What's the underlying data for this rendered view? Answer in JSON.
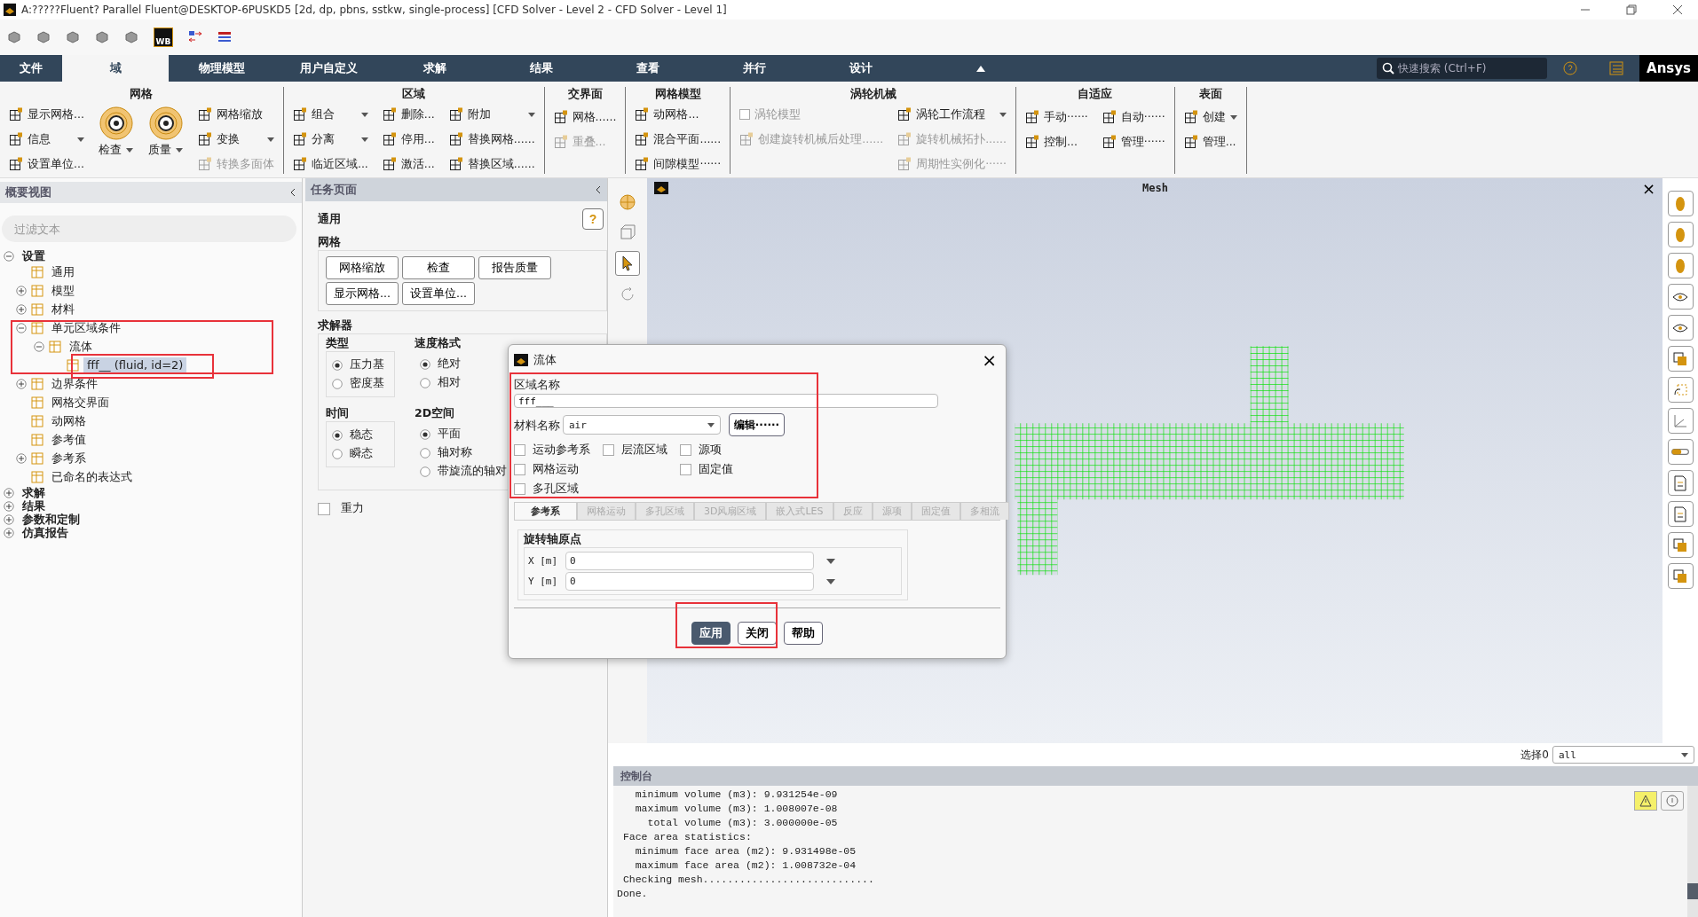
{
  "window": {
    "title": "A:?????Fluent? Parallel Fluent@DESKTOP-6PUSKD5  [2d, dp, pbns, sstkw, single-process] [CFD Solver - Level 2 - CFD Solver - Level 1]"
  },
  "quick_toolbar": {
    "wb_label": "WB"
  },
  "menu_tabs": [
    {
      "label": "文件",
      "selected": false
    },
    {
      "label": "域",
      "selected": true
    },
    {
      "label": "物理模型",
      "selected": false
    },
    {
      "label": "用户自定义",
      "selected": false
    },
    {
      "label": "求解",
      "selected": false
    },
    {
      "label": "结果",
      "selected": false
    },
    {
      "label": "查看",
      "selected": false
    },
    {
      "label": "并行",
      "selected": false
    },
    {
      "label": "设计",
      "selected": false
    }
  ],
  "search": {
    "placeholder": "快速搜索 (Ctrl+F)"
  },
  "brand": "Ansys",
  "ribbon": [
    {
      "title": "网格",
      "columns": [
        [
          {
            "label": "显示网格...",
            "kind": "small",
            "disabled": false,
            "dropdown": false
          },
          {
            "label": "信息",
            "kind": "small",
            "disabled": false,
            "dropdown": true
          },
          {
            "label": "设置单位...",
            "kind": "small",
            "disabled": false,
            "dropdown": false
          }
        ],
        [
          {
            "label": "检查",
            "kind": "large",
            "disabled": false,
            "dropdown": true
          }
        ],
        [
          {
            "label": "质量",
            "kind": "large",
            "disabled": false,
            "dropdown": true
          }
        ],
        [
          {
            "label": "网格缩放",
            "kind": "small",
            "disabled": false,
            "dropdown": false
          },
          {
            "label": "变换",
            "kind": "small",
            "disabled": false,
            "dropdown": true
          },
          {
            "label": "转换多面体",
            "kind": "small",
            "disabled": true,
            "dropdown": false
          }
        ]
      ]
    },
    {
      "title": "区域",
      "columns": [
        [
          {
            "label": "组合",
            "kind": "small",
            "disabled": false,
            "dropdown": true
          },
          {
            "label": "分离",
            "kind": "small",
            "disabled": false,
            "dropdown": true
          },
          {
            "label": "临近区域...",
            "kind": "small",
            "disabled": false,
            "dropdown": false
          }
        ],
        [
          {
            "label": "删除...",
            "kind": "small",
            "disabled": false,
            "dropdown": false
          },
          {
            "label": "停用...",
            "kind": "small",
            "disabled": false,
            "dropdown": false
          },
          {
            "label": "激活...",
            "kind": "small",
            "disabled": false,
            "dropdown": false
          }
        ],
        [
          {
            "label": "附加",
            "kind": "small",
            "disabled": false,
            "dropdown": true
          },
          {
            "label": "替换网格......",
            "kind": "small",
            "disabled": false,
            "dropdown": false
          },
          {
            "label": "替换区域......",
            "kind": "small",
            "disabled": false,
            "dropdown": false
          }
        ]
      ]
    },
    {
      "title": "交界面",
      "columns": [
        [
          {
            "label": "网格......",
            "kind": "small",
            "disabled": false,
            "dropdown": false
          },
          {
            "label": "重叠...",
            "kind": "small",
            "disabled": true,
            "dropdown": false
          }
        ]
      ]
    },
    {
      "title": "网格模型",
      "columns": [
        [
          {
            "label": "动网格...",
            "kind": "small",
            "disabled": false,
            "dropdown": false
          },
          {
            "label": "混合平面......",
            "kind": "small",
            "disabled": false,
            "dropdown": false
          },
          {
            "label": "间隙模型······",
            "kind": "small",
            "disabled": false,
            "dropdown": false
          }
        ]
      ]
    },
    {
      "title": "涡轮机械",
      "columns": [
        [
          {
            "label": "涡轮模型",
            "kind": "checkbox",
            "disabled": true,
            "checked": false
          },
          {
            "label": "创建旋转机械后处理......",
            "kind": "small",
            "disabled": true,
            "dropdown": false
          }
        ],
        [
          {
            "label": "涡轮工作流程",
            "kind": "small",
            "disabled": false,
            "dropdown": true
          },
          {
            "label": "旋转机械拓扑......",
            "kind": "small",
            "disabled": true,
            "dropdown": false
          },
          {
            "label": "周期性实例化······",
            "kind": "small",
            "disabled": true,
            "dropdown": false
          }
        ]
      ]
    },
    {
      "title": "自适应",
      "columns": [
        [
          {
            "label": "手动······",
            "kind": "small",
            "disabled": false,
            "dropdown": false
          },
          {
            "label": "控制...",
            "kind": "small",
            "disabled": false,
            "dropdown": false
          }
        ],
        [
          {
            "label": "自动······",
            "kind": "small",
            "disabled": false,
            "dropdown": false
          },
          {
            "label": "管理······",
            "kind": "small",
            "disabled": false,
            "dropdown": false
          }
        ]
      ]
    },
    {
      "title": "表面",
      "columns": [
        [
          {
            "label": "创建",
            "kind": "small",
            "disabled": false,
            "dropdown": true
          },
          {
            "label": "管理...",
            "kind": "small",
            "disabled": false,
            "dropdown": false
          }
        ]
      ]
    }
  ],
  "outline": {
    "title": "概要视图",
    "filter_placeholder": "过滤文本",
    "tree": [
      {
        "label": "设置",
        "expanded": true,
        "selected": false,
        "children": [
          {
            "label": "通用",
            "selected": false
          },
          {
            "label": "模型",
            "expanded": false,
            "selected": false
          },
          {
            "label": "材料",
            "expanded": false,
            "selected": false
          },
          {
            "label": "单元区域条件",
            "expanded": true,
            "selected": false,
            "children": [
              {
                "label": "流体",
                "expanded": true,
                "selected": false,
                "children": [
                  {
                    "label": "fff__ (fluid, id=2)",
                    "selected": true
                  }
                ]
              }
            ]
          },
          {
            "label": "边界条件",
            "expanded": false,
            "selected": false
          },
          {
            "label": "网格交界面",
            "selected": false
          },
          {
            "label": "动网格",
            "selected": false
          },
          {
            "label": "参考值",
            "selected": false
          },
          {
            "label": "参考系",
            "expanded": false,
            "selected": false
          },
          {
            "label": "已命名的表达式",
            "selected": false
          }
        ]
      },
      {
        "label": "求解",
        "expanded": false,
        "selected": false
      },
      {
        "label": "结果",
        "expanded": false,
        "selected": false
      },
      {
        "label": "参数和定制",
        "expanded": false,
        "selected": false
      },
      {
        "label": "仿真报告",
        "expanded": false,
        "selected": false
      }
    ]
  },
  "task_page": {
    "title": "任务页面",
    "section": "通用",
    "help": "?",
    "mesh_title": "网格",
    "mesh_buttons": [
      [
        "网格缩放",
        "检查",
        "报告质量"
      ],
      [
        "显示网格...",
        "设置单位..."
      ]
    ],
    "solver_title": "求解器",
    "radio_groups": [
      {
        "title": "类型",
        "options": [
          {
            "label": "压力基",
            "selected": true
          },
          {
            "label": "密度基",
            "selected": false
          }
        ]
      },
      {
        "title": "速度格式",
        "options": [
          {
            "label": "绝对",
            "selected": true
          },
          {
            "label": "相对",
            "selected": false
          }
        ]
      },
      {
        "title": "时间",
        "options": [
          {
            "label": "稳态",
            "selected": true
          },
          {
            "label": "瞬态",
            "selected": false
          }
        ]
      },
      {
        "title": "2D空间",
        "options": [
          {
            "label": "平面",
            "selected": true
          },
          {
            "label": "轴对称",
            "selected": false
          },
          {
            "label": "带旋流的轴对",
            "selected": false
          }
        ]
      }
    ],
    "gravity": {
      "label": "重力",
      "checked": false
    }
  },
  "graphics": {
    "title": "Mesh",
    "close": "×"
  },
  "selection": {
    "label": "选择0",
    "value": "all"
  },
  "console": {
    "title": "控制台",
    "lines": [
      "   minimum volume (m3): 9.931254e-09",
      "   maximum volume (m3): 1.008007e-08",
      "     total volume (m3): 3.000000e-05",
      " Face area statistics:",
      "   minimum face area (m2): 9.931498e-05",
      "   maximum face area (m2): 1.008732e-04",
      " Checking mesh............................",
      "Done."
    ]
  },
  "dialog": {
    "title": "流体",
    "close": "×",
    "zone_label": "区域名称",
    "zone_value": "fff___",
    "material_label": "材料名称",
    "material_value": "air",
    "edit_button": "编辑······",
    "checkbox_columns": [
      [
        {
          "label": "运动参考系",
          "checked": false
        },
        {
          "label": "网格运动",
          "checked": false
        },
        {
          "label": "多孔区域",
          "checked": false
        }
      ],
      [
        {
          "label": "层流区域",
          "checked": false
        }
      ],
      [
        {
          "label": "源项",
          "checked": false
        },
        {
          "label": "固定值",
          "checked": false
        }
      ]
    ],
    "tabs": [
      {
        "label": "参考系",
        "selected": true
      },
      {
        "label": "网格运动",
        "selected": false
      },
      {
        "label": "多孔区域",
        "selected": false
      },
      {
        "label": "3D风扇区域",
        "selected": false
      },
      {
        "label": "嵌入式LES",
        "selected": false
      },
      {
        "label": "反应",
        "selected": false
      },
      {
        "label": "源项",
        "selected": false
      },
      {
        "label": "固定值",
        "selected": false
      },
      {
        "label": "多相流",
        "selected": false
      }
    ],
    "group_title": "旋转轴原点",
    "fields": [
      {
        "label": "X [m]",
        "value": "0"
      },
      {
        "label": "Y [m]",
        "value": "0"
      }
    ],
    "buttons": [
      {
        "label": "应用",
        "kind": "primary"
      },
      {
        "label": "关闭",
        "kind": "normal"
      },
      {
        "label": "帮助",
        "kind": "normal"
      }
    ]
  }
}
